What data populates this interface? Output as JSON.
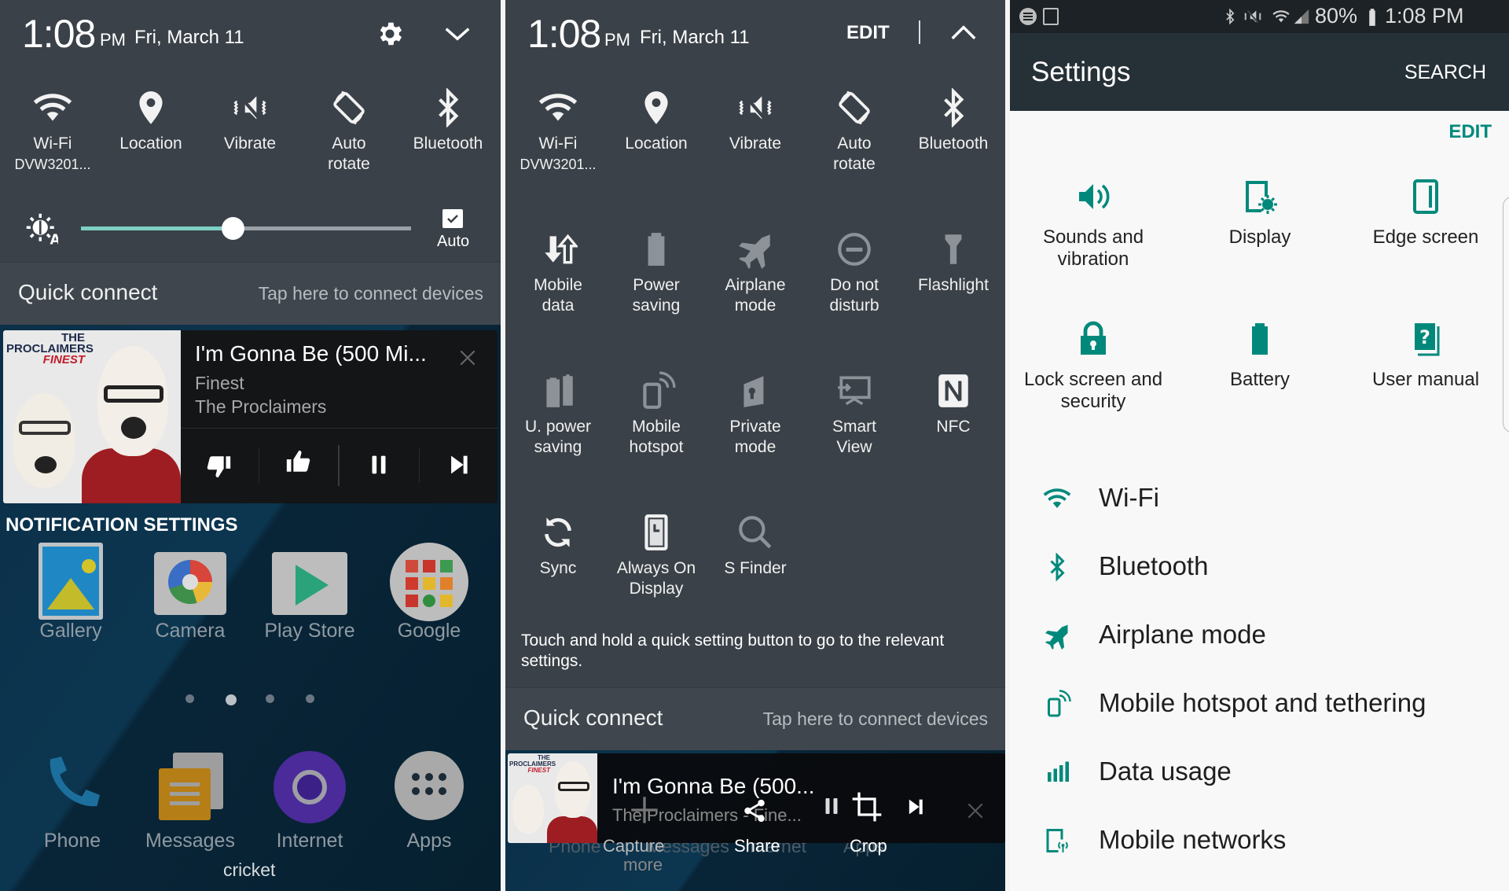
{
  "colors": {
    "panel_bg": "#3a4148",
    "accent_teal": "#00897b",
    "slider_fill": "#7ccfc3",
    "settings_header": "#263037",
    "settings_bg": "#f8f8f8"
  },
  "left": {
    "time": "1:08",
    "ampm": "PM",
    "date": "Fri, March 11",
    "tiles": [
      {
        "label": "Wi-Fi",
        "sub": "DVW3201...",
        "icon": "wifi-icon"
      },
      {
        "label": "Location",
        "sub": "",
        "icon": "location-pin-icon"
      },
      {
        "label": "Vibrate",
        "sub": "",
        "icon": "vibrate-icon"
      },
      {
        "label": "Auto",
        "sub": "rotate",
        "icon": "auto-rotate-icon"
      },
      {
        "label": "Bluetooth",
        "sub": "",
        "icon": "bluetooth-icon"
      }
    ],
    "brightness": {
      "level": 0.46,
      "auto_label": "Auto",
      "auto_checked": true
    },
    "quick_connect": {
      "title": "Quick connect",
      "hint": "Tap here to connect devices"
    },
    "music": {
      "album_top": "THE",
      "album_band": "PROCLAIMERS",
      "album_name": "FINEST",
      "title": "I'm Gonna Be (500 Mi...",
      "album": "Finest",
      "artist": "The Proclaimers"
    },
    "notification_settings": "NOTIFICATION SETTINGS",
    "apps": [
      "Gallery",
      "Camera",
      "Play Store",
      "Google"
    ],
    "page_dots": {
      "count": 4,
      "active": 1
    },
    "dock": [
      "Phone",
      "Messages",
      "Internet",
      "Apps"
    ],
    "carrier": "cricket"
  },
  "middle": {
    "time": "1:08",
    "ampm": "PM",
    "date": "Fri, March 11",
    "edit": "EDIT",
    "tiles": [
      {
        "label": "Wi-Fi",
        "sub": "DVW3201...",
        "icon": "wifi-icon",
        "active": true
      },
      {
        "label": "Location",
        "sub": "",
        "icon": "location-pin-icon",
        "active": true
      },
      {
        "label": "Vibrate",
        "sub": "",
        "icon": "vibrate-icon",
        "active": true
      },
      {
        "label": "Auto",
        "sub": "rotate",
        "icon": "auto-rotate-icon",
        "active": true
      },
      {
        "label": "Bluetooth",
        "sub": "",
        "icon": "bluetooth-icon",
        "active": true
      },
      {
        "label": "Mobile",
        "sub": "data",
        "icon": "mobile-data-icon",
        "active": true
      },
      {
        "label": "Power",
        "sub": "saving",
        "icon": "power-saving-icon",
        "active": false
      },
      {
        "label": "Airplane",
        "sub": "mode",
        "icon": "airplane-icon",
        "active": false
      },
      {
        "label": "Do not",
        "sub": "disturb",
        "icon": "do-not-disturb-icon",
        "active": false
      },
      {
        "label": "Flashlight",
        "sub": "",
        "icon": "flashlight-icon",
        "active": false
      },
      {
        "label": "U. power",
        "sub": "saving",
        "icon": "ultra-power-saving-icon",
        "active": false
      },
      {
        "label": "Mobile",
        "sub": "hotspot",
        "icon": "mobile-hotspot-icon",
        "active": false
      },
      {
        "label": "Private",
        "sub": "mode",
        "icon": "private-mode-icon",
        "active": false
      },
      {
        "label": "Smart",
        "sub": "View",
        "icon": "smart-view-icon",
        "active": false
      },
      {
        "label": "NFC",
        "sub": "",
        "icon": "nfc-icon",
        "active": true
      },
      {
        "label": "Sync",
        "sub": "",
        "icon": "sync-icon",
        "active": true
      },
      {
        "label": "Always On",
        "sub": "Display",
        "icon": "always-on-display-icon",
        "active": true
      },
      {
        "label": "S Finder",
        "sub": "",
        "icon": "s-finder-icon",
        "active": false
      }
    ],
    "hint": "Touch and hold a quick setting button to go to the relevant settings.",
    "quick_connect": {
      "title": "Quick connect",
      "hint": "Tap here to connect devices"
    },
    "music": {
      "title": "I'm Gonna Be (500...",
      "subtitle": "The Proclaimers - Fine..."
    },
    "capture_actions": [
      {
        "label": "Capture",
        "sub": "more"
      },
      {
        "label": "Share",
        "sub": ""
      },
      {
        "label": "Crop",
        "sub": ""
      }
    ],
    "behind_labels": [
      "Phone",
      "Messages",
      "Internet",
      "Apps"
    ]
  },
  "right": {
    "status": {
      "battery": "80%",
      "time": "1:08 PM"
    },
    "title": "Settings",
    "search": "SEARCH",
    "edit": "EDIT",
    "grid": [
      {
        "label": "Sounds and",
        "sub": "vibration",
        "icon": "speaker-icon"
      },
      {
        "label": "Display",
        "sub": "",
        "icon": "display-icon"
      },
      {
        "label": "Edge screen",
        "sub": "",
        "icon": "edge-screen-icon"
      },
      {
        "label": "Lock screen and",
        "sub": "security",
        "icon": "lock-icon"
      },
      {
        "label": "Battery",
        "sub": "",
        "icon": "battery-icon"
      },
      {
        "label": "User manual",
        "sub": "",
        "icon": "user-manual-icon"
      }
    ],
    "list": [
      {
        "label": "Wi-Fi",
        "icon": "wifi-icon"
      },
      {
        "label": "Bluetooth",
        "icon": "bluetooth-icon"
      },
      {
        "label": "Airplane mode",
        "icon": "airplane-icon"
      },
      {
        "label": "Mobile hotspot and tethering",
        "icon": "mobile-hotspot-icon"
      },
      {
        "label": "Data usage",
        "icon": "data-usage-icon"
      },
      {
        "label": "Mobile networks",
        "icon": "mobile-networks-icon"
      }
    ]
  }
}
